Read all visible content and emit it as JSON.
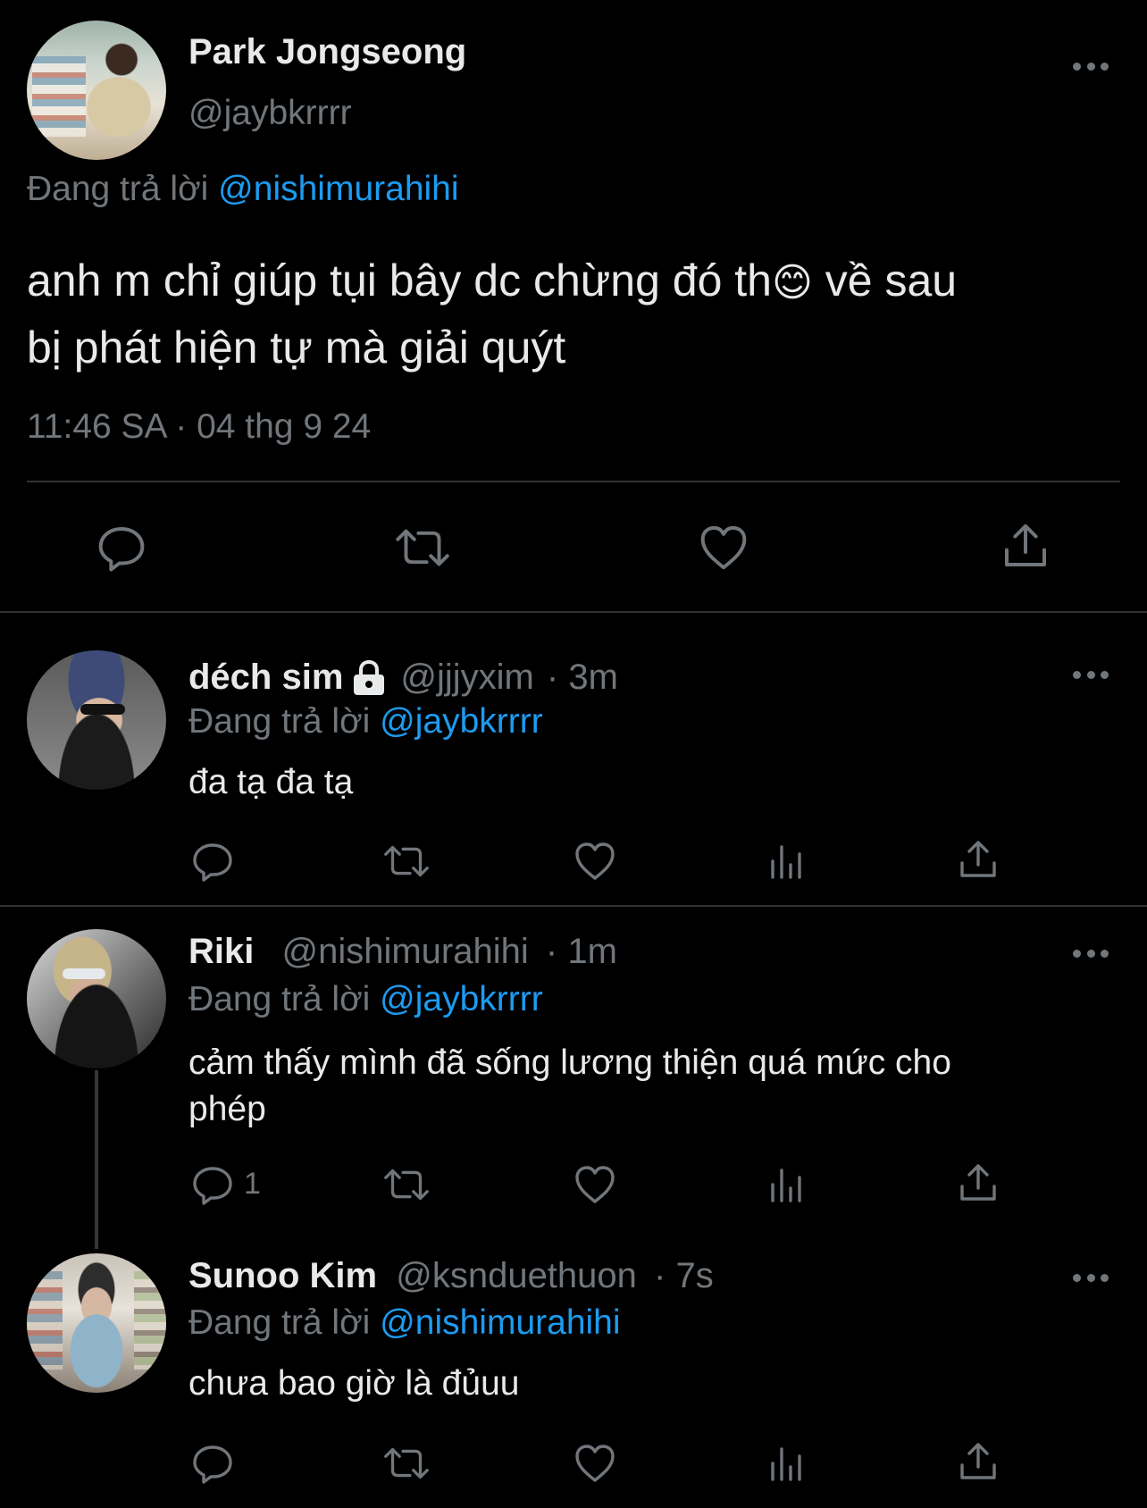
{
  "main_tweet": {
    "display_name": "Park Jongseong",
    "handle": "@jaybkrrrr",
    "reply_prefix": "Đang trả lời",
    "reply_to": "@nishimurahihi",
    "text_line1": "anh m chỉ giúp tụi bây dc chừng đó th",
    "emoji": "😊",
    "text_line1_end": "về sau",
    "text_line2": "bị phát hiện tự mà giải quýt",
    "timestamp": "11:46 SA · 04 thg 9 24"
  },
  "replies": [
    {
      "display_name": "déch sim",
      "protected": true,
      "handle": "@jjjyxim",
      "time": "· 3m",
      "reply_prefix": "Đang trả lời",
      "reply_to": "@jaybkrrrr",
      "text": "đa tạ đa tạ",
      "reply_count": ""
    },
    {
      "display_name": "Riki",
      "protected": false,
      "handle": "@nishimurahihi",
      "time": "· 1m",
      "reply_prefix": "Đang trả lời",
      "reply_to": "@jaybkrrrr",
      "text_line1": "cảm thấy mình đã sống lương thiện quá mức cho",
      "text_line2": "phép",
      "reply_count": "1"
    },
    {
      "display_name": "Sunoo Kim",
      "protected": false,
      "handle": "@ksnduethuon",
      "time": "· 7s",
      "reply_prefix": "Đang trả lời",
      "reply_to": "@nishimurahihi",
      "text": "chưa bao giờ là đủuu",
      "reply_count": ""
    }
  ],
  "icons": [
    "reply-icon",
    "retweet-icon",
    "like-icon",
    "views-icon",
    "share-icon",
    "more-icon",
    "lock-icon"
  ],
  "colors": {
    "background": "#000000",
    "text": "#e7e9ea",
    "muted": "#71767b",
    "link": "#1d9bf0",
    "divider": "#2f3336"
  }
}
